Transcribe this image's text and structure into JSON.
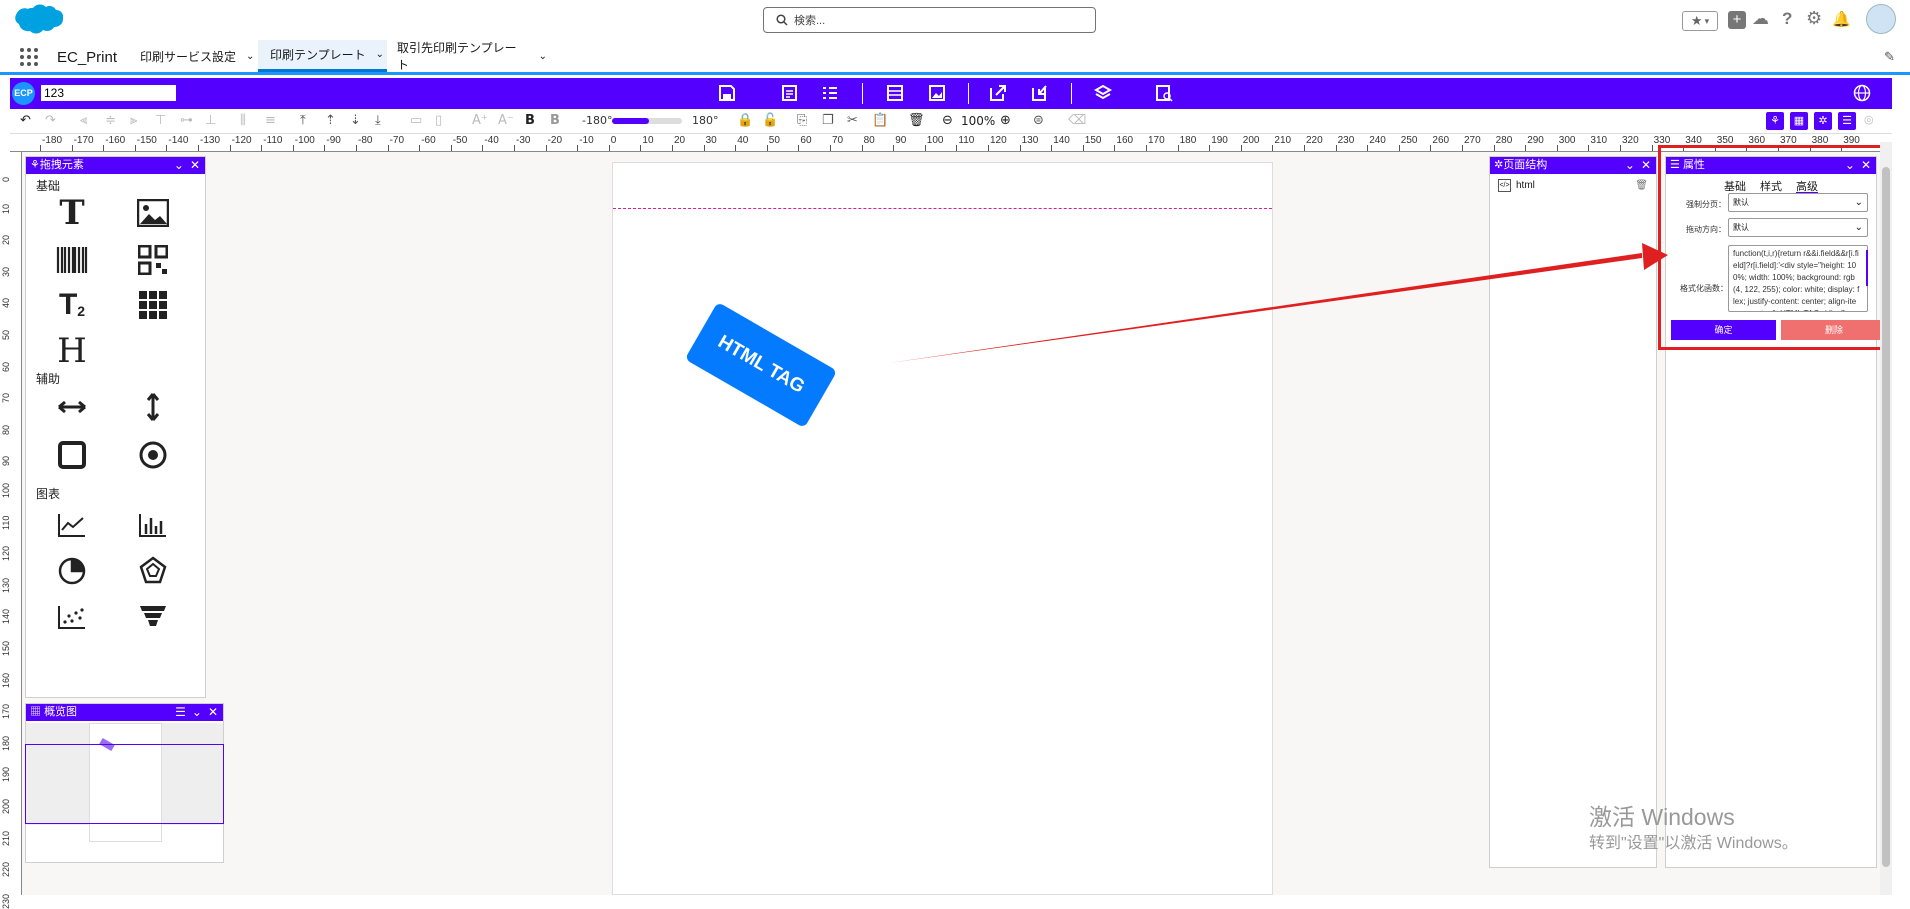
{
  "topbar": {
    "search_placeholder": "検索..."
  },
  "nav": {
    "app_name": "EC_Print",
    "tabs": [
      {
        "label": "印刷サービス設定"
      },
      {
        "label": "印刷テンプレート"
      },
      {
        "label": "取引先印刷テンプレート"
      }
    ]
  },
  "ecp": {
    "badge": "ECP",
    "template_name": "123"
  },
  "toolbar": {
    "rotate_min": "-180°",
    "rotate_max": "180°",
    "zoom": "100%",
    "bold_a": "B",
    "bold_b": "B"
  },
  "ruler": {
    "top": [
      "-180",
      "-170",
      "-160",
      "-150",
      "-140",
      "-130",
      "-120",
      "-110",
      "-100",
      "-90",
      "-80",
      "-70",
      "-60",
      "-50",
      "-40",
      "-30",
      "-20",
      "-10",
      "0",
      "10",
      "20",
      "30",
      "40",
      "50",
      "60",
      "70",
      "80",
      "90",
      "100",
      "110",
      "120",
      "130",
      "140",
      "150",
      "160",
      "170",
      "180",
      "190",
      "200",
      "210",
      "220",
      "230",
      "240",
      "250",
      "260",
      "270",
      "280",
      "290",
      "300",
      "310",
      "320",
      "330",
      "340",
      "350",
      "360",
      "370",
      "380",
      "390"
    ],
    "left": [
      "0",
      "10",
      "20",
      "30",
      "40",
      "50",
      "60",
      "70",
      "80",
      "90",
      "100",
      "110",
      "120",
      "130",
      "140",
      "150",
      "160",
      "170",
      "180",
      "190",
      "200",
      "210",
      "220",
      "230"
    ]
  },
  "elements_panel": {
    "title": "拖拽元素",
    "sections": {
      "basic": "基础",
      "aux": "辅助",
      "chart": "图表"
    }
  },
  "overview_panel": {
    "title": "概览图"
  },
  "structure_panel": {
    "title": "页面结构",
    "items": [
      {
        "label": "html"
      }
    ]
  },
  "props_panel": {
    "title": "属性",
    "tabs": [
      "基础",
      "样式",
      "高级"
    ],
    "active_tab": "高级",
    "fields": {
      "pagination_label": "强制分页：",
      "pagination_value": "默认",
      "drag_label": "拖动方向：",
      "drag_value": "默认",
      "formatter_label": "格式化函数：",
      "formatter_value": "function(t,i,r){return r&&i.field&&r[i.field]?r[i.field]:'<div style=\"height: 100%; width: 100%; background: rgb(4, 122, 255); color: white; display: flex; justify-content: center; align-items: center;\">HTML TAG</div>'}"
    },
    "confirm": "确定",
    "delete": "删除"
  },
  "canvas": {
    "html_tag_text": "HTML TAG"
  },
  "watermark": {
    "line1": "激活 Windows",
    "line2": "转到\"设置\"以激活 Windows。"
  },
  "colors": {
    "brand": "#5300ff",
    "tag_blue": "#047aff",
    "highlight_red": "#e02020",
    "delete_red": "#f07070"
  }
}
